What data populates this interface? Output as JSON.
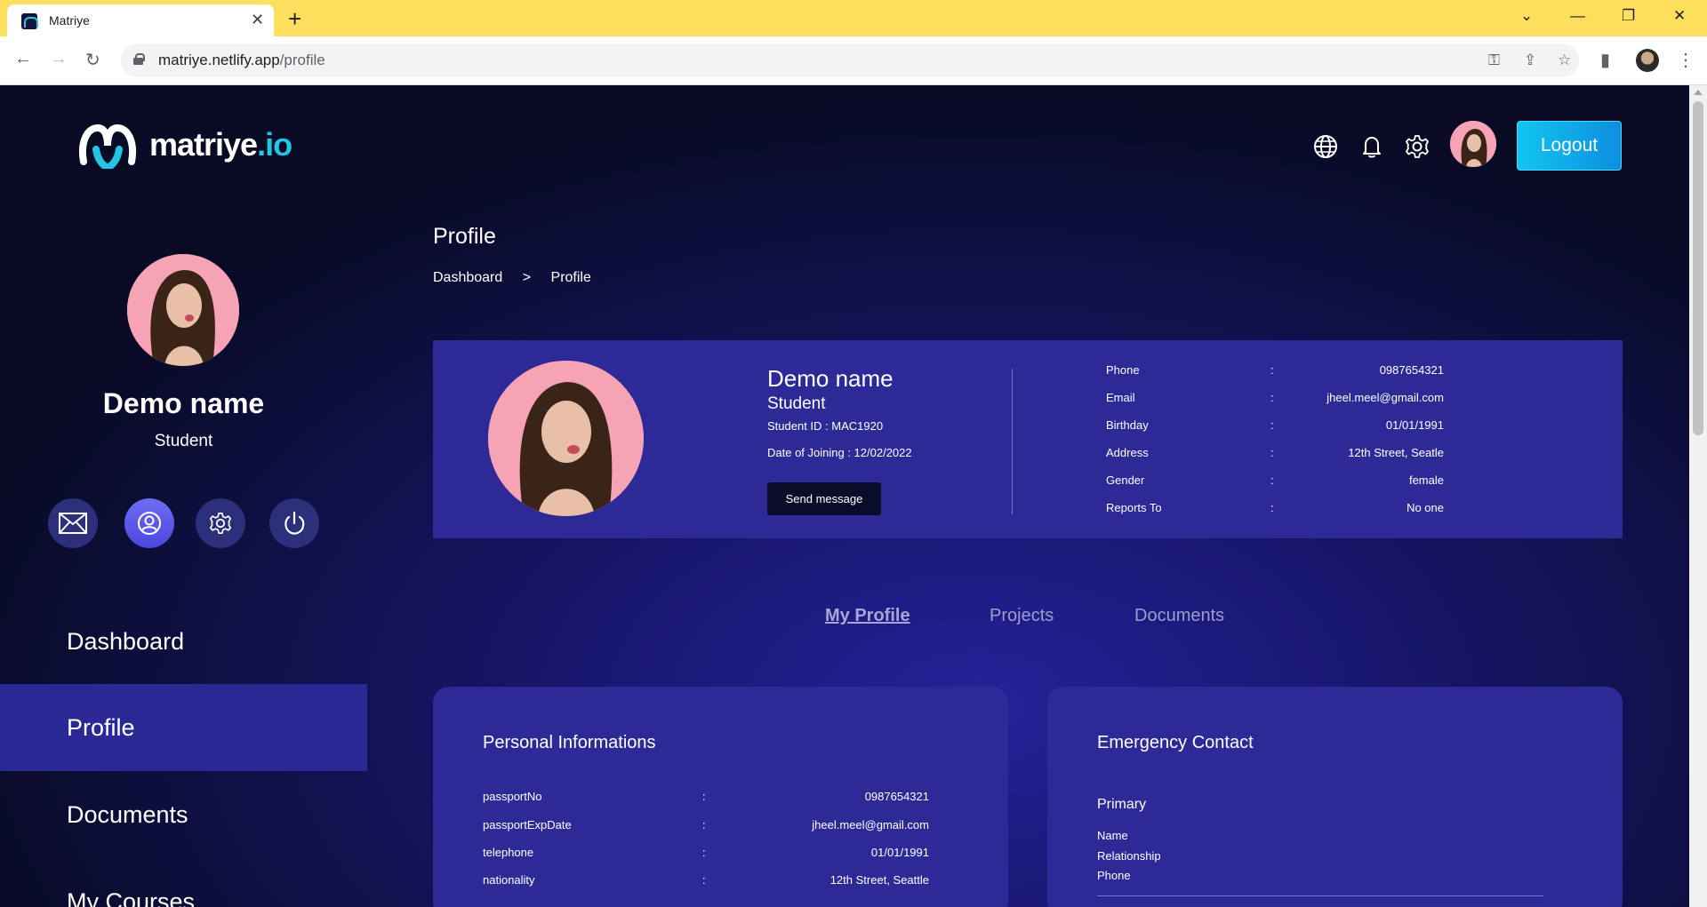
{
  "browser": {
    "tab_title": "Matriye",
    "url_host": "matriye.netlify.app",
    "url_path": "/profile"
  },
  "header": {
    "logo_text": "matriye",
    "logo_suffix": ".io",
    "logout_label": "Logout"
  },
  "sidebar": {
    "name": "Demo name",
    "role": "Student",
    "nav": [
      {
        "label": "Dashboard",
        "active": false
      },
      {
        "label": "Profile",
        "active": true
      },
      {
        "label": "Documents",
        "active": false
      },
      {
        "label": "My Courses",
        "active": false
      }
    ]
  },
  "page": {
    "title": "Profile",
    "breadcrumb": [
      "Dashboard",
      ">",
      "Profile"
    ]
  },
  "profile_card": {
    "name": "Demo name",
    "role": "Student",
    "student_id": "Student ID : MAC1920",
    "date_of_joining": "Date of Joining : 12/02/2022",
    "send_message_label": "Send message",
    "details": [
      {
        "label": "Phone",
        "value": "0987654321"
      },
      {
        "label": "Email",
        "value": "jheel.meel@gmail.com"
      },
      {
        "label": "Birthday",
        "value": "01/01/1991"
      },
      {
        "label": "Address",
        "value": "12th Street, Seatle"
      },
      {
        "label": "Gender",
        "value": "female"
      },
      {
        "label": "Reports To",
        "value": "No one"
      }
    ]
  },
  "tabs": [
    {
      "label": "My Profile",
      "active": true
    },
    {
      "label": "Projects",
      "active": false
    },
    {
      "label": "Documents",
      "active": false
    }
  ],
  "personal_info": {
    "title": "Personal Informations",
    "rows": [
      {
        "label": "passportNo",
        "value": "0987654321"
      },
      {
        "label": "passportExpDate",
        "value": "jheel.meel@gmail.com"
      },
      {
        "label": "telephone",
        "value": "01/01/1991"
      },
      {
        "label": "nationality",
        "value": "12th Street, Seattle"
      }
    ]
  },
  "emergency_contact": {
    "title": "Emergency Contact",
    "primary_label": "Primary",
    "fields": [
      "Name",
      "Relationship",
      "Phone"
    ]
  },
  "colors": {
    "accent": "#10c5ef",
    "card": "#2d2a98",
    "active_nav": "#2a2895",
    "chrome_tabbar": "#fedf5d"
  }
}
